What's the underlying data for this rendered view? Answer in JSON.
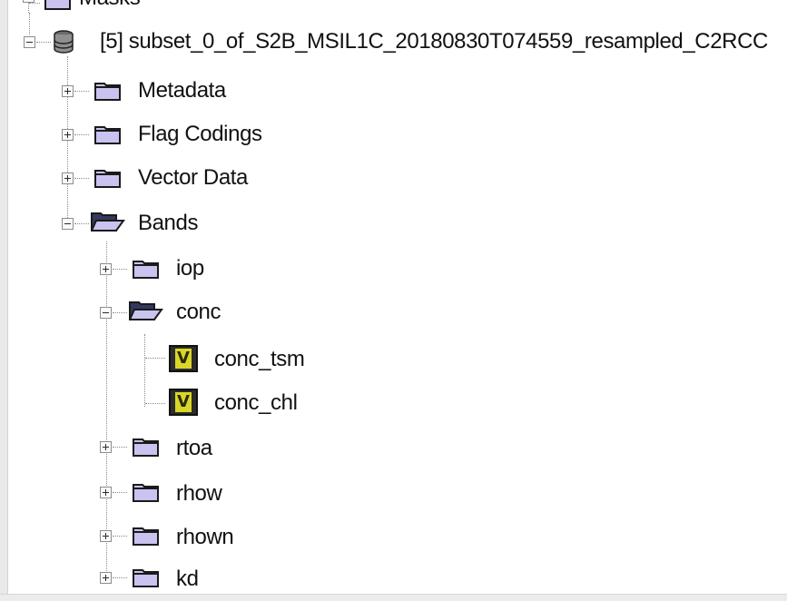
{
  "tree": {
    "top_partial": {
      "label": "Masks"
    },
    "product": {
      "label": "[5] subset_0_of_S2B_MSIL1C_20180830T074559_resampled_C2RCC"
    },
    "groups": [
      {
        "label": "Metadata",
        "expanded": false
      },
      {
        "label": "Flag Codings",
        "expanded": false
      },
      {
        "label": "Vector Data",
        "expanded": false
      },
      {
        "label": "Bands",
        "expanded": true
      }
    ],
    "bands": [
      {
        "label": "iop",
        "expanded": false
      },
      {
        "label": "conc",
        "expanded": true
      },
      {
        "label": "rtoa",
        "expanded": false
      },
      {
        "label": "rhow",
        "expanded": false
      },
      {
        "label": "rhown",
        "expanded": false
      },
      {
        "label": "kd",
        "expanded": false
      }
    ],
    "conc_children": [
      {
        "label": "conc_tsm",
        "icon_letter": "V"
      },
      {
        "label": "conc_chl",
        "icon_letter": "V"
      }
    ]
  },
  "colors": {
    "folder_light": "#c9c3ef",
    "folder_dark": "#33385e",
    "band_icon": "#d9d62a"
  },
  "icons": {
    "product": "database-icon",
    "folder": "folder-icon",
    "band": "virtual-band-icon"
  }
}
